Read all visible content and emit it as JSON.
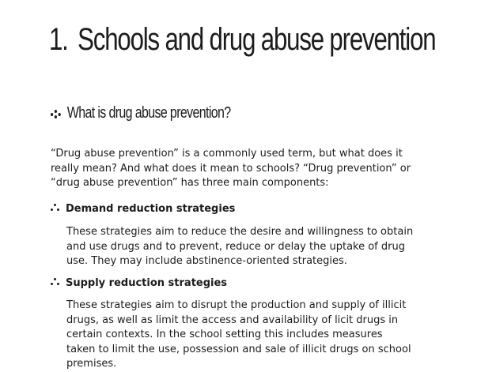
{
  "chapter": {
    "number": "1.",
    "title": "Schools and drug abuse prevention"
  },
  "section": {
    "heading": "What is drug abuse prevention?",
    "icon": "dots-icon"
  },
  "intro": {
    "text": "“Drug abuse prevention” is a commonly used term, but what does it really mean? And what does it mean to schools? “Drug prevention” or “drug abuse prevention” has three main components:"
  },
  "components": [
    {
      "heading": "Demand reduction strategies",
      "icon": "bullet-dots-icon",
      "body": "These strategies aim to reduce the desire and willingness to obtain and use drugs and to prevent, reduce or delay the uptake of drug use. They may include abstinence-oriented strategies."
    },
    {
      "heading": "Supply reduction strategies",
      "icon": "bullet-dots-icon",
      "body": "These strategies aim to disrupt the production and supply of illicit drugs, as well as limit the access and availability of licit drugs in certain contexts. In the school setting this includes measures taken to limit the use, possession and sale of illicit drugs on school premises."
    }
  ]
}
